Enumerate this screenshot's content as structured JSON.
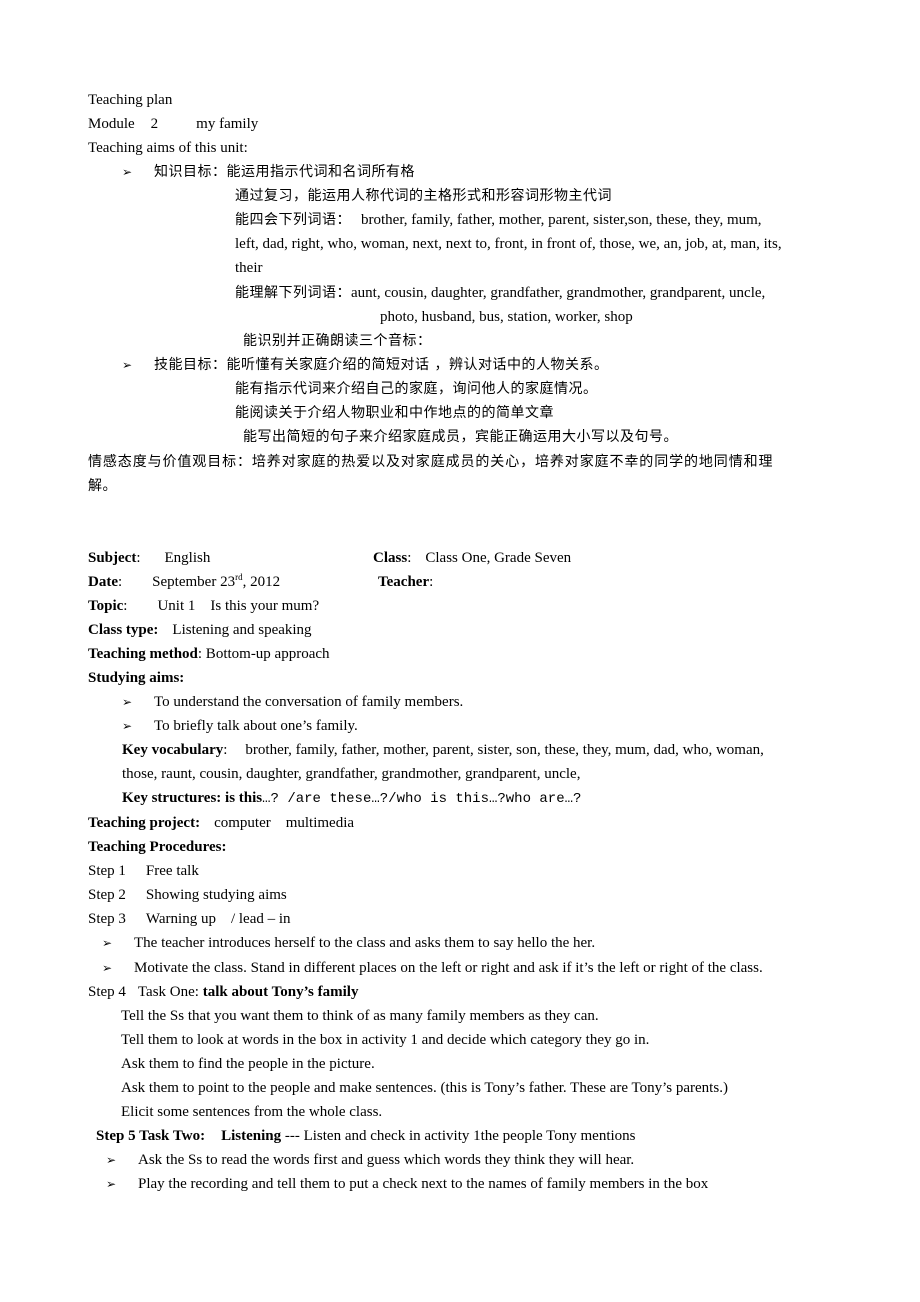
{
  "header": {
    "title": "Teaching plan",
    "module_label": "Module",
    "module_number": "2",
    "module_name": "my family",
    "aims_heading": "Teaching aims of this unit:"
  },
  "aims": {
    "bullet": "➢",
    "knowledge": {
      "label": "知识目标：",
      "line1": "能运用指示代词和名词所有格",
      "line2": "通过复习，能运用人称代词的主格形式和形容词形物主代词",
      "line3_label": "能四会下列词语：",
      "line3_words": "brother, family, father, mother, parent, sister,son, these, they, mum,",
      "line4": "left, dad, right, who, woman, next, next to, front, in front of, those, we, an, job, at, man, its,",
      "line5": "their",
      "line6_label": "能理解下列词语：",
      "line6_words": "aunt, cousin, daughter, grandfather, grandmother, grandparent, uncle,",
      "line7": "photo, husband, bus, station, worker, shop",
      "line8": "能识别并正确朗读三个音标："
    },
    "skills": {
      "label": "技能目标：",
      "line1": "能听懂有关家庭介绍的简短对话 ，辨认对话中的人物关系。",
      "line2": "能有指示代词来介绍自己的家庭，询问他人的家庭情况。",
      "line3": "能阅读关于介绍人物职业和中作地点的的简单文章",
      "line4": "能写出简短的句子来介绍家庭成员，宾能正确运用大小写以及句号。"
    },
    "emotion": {
      "line1": "情感态度与价值观目标：培养对家庭的热爱以及对家庭成员的关心，培养对家庭不幸的同学的地同情和理",
      "line2": "解。"
    }
  },
  "info": {
    "subject_label": "Subject",
    "subject_value": "English",
    "class_label": "Class",
    "class_value": "Class One, Grade Seven",
    "date_label": "Date",
    "date_value_pre": "September 23",
    "date_value_sup": "rd",
    "date_value_post": ", 2012",
    "teacher_label": "Teacher",
    "teacher_value": "",
    "topic_label": "Topic",
    "topic_value": "Unit 1    Is this your mum?",
    "class_type_label": "Class type:",
    "class_type_value": "Listening and speaking",
    "method_label": "Teaching method",
    "method_value": ": Bottom-up approach",
    "studying_aims_label": "Studying aims:"
  },
  "studying_aims": {
    "items": [
      "To understand the conversation of family members.",
      "To briefly talk about one’s family."
    ],
    "key_vocab_label": "Key vocabulary",
    "key_vocab_line1": "brother, family, father, mother, parent, sister, son, these, they, mum, dad, who, woman,",
    "key_vocab_line2": "those, raunt, cousin, daughter, grandfather, grandmother, grandparent, uncle,",
    "key_structures_label": "Key structures: is this",
    "key_structures_value": "…? /are these…?/who is this…?who are…?"
  },
  "project": {
    "label": "Teaching project:",
    "value": "computer    multimedia"
  },
  "procedures": {
    "heading": "Teaching Procedures:",
    "step1": {
      "label": "Step 1",
      "text": "Free talk"
    },
    "step2": {
      "label": "Step 2",
      "text": "Showing studying aims"
    },
    "step3": {
      "label": "Step 3",
      "text": "Warning up    / lead – in",
      "bullets": [
        "The teacher introduces herself to the class and asks them to say hello the her.",
        "Motivate the class. Stand in different places on the left or right and ask if it’s the left or right of the class."
      ]
    },
    "step4": {
      "label": "Step 4",
      "task": "Task One: ",
      "title": "talk about Tony’s family",
      "lines": [
        "Tell the Ss that you want them to think of as many family members as they can.",
        "Tell them to look at words in the box in activity 1 and decide which category they go in.",
        "Ask them to find the people in the picture.",
        "Ask them to point to the people and make sentences. (this is Tony’s father. These are Tony’s parents.)",
        "Elicit some sentences from the whole class."
      ]
    },
    "step5": {
      "label": "Step 5 Task Two:",
      "title": "Listening",
      "text": " --- Listen and check in activity 1the people Tony mentions",
      "bullets": [
        "Ask the Ss to read the words first and guess which words they think they will hear.",
        "Play the recording and tell them to put a check next to the names of family members in the box"
      ]
    }
  }
}
